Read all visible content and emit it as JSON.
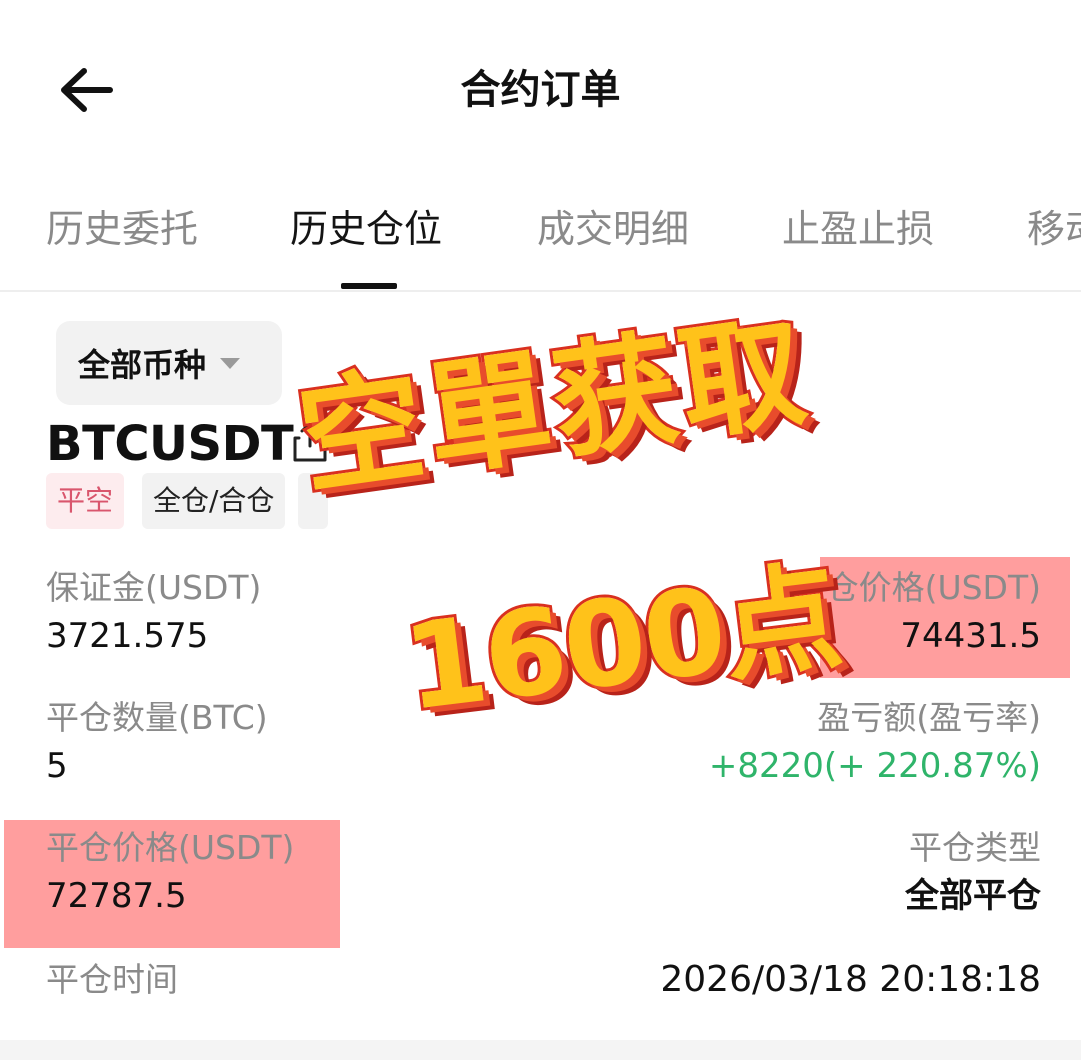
{
  "header": {
    "title": "合约订单",
    "back_icon": "arrow-left-icon"
  },
  "tabs": [
    {
      "label": "历史委托",
      "active": false
    },
    {
      "label": "历史仓位",
      "active": true
    },
    {
      "label": "成交明细",
      "active": false
    },
    {
      "label": "止盈止损",
      "active": false
    },
    {
      "label": "移动",
      "active": false
    }
  ],
  "filter": {
    "label": "全部币种"
  },
  "position": {
    "symbol": "BTCUSDT",
    "side_tag": "平空",
    "mode_tag": "全仓/合仓",
    "margin_label": "保证金(USDT)",
    "margin_value": "3721.575",
    "open_price_label": "开仓价格(USDT)",
    "open_price_value": "74431.5",
    "close_qty_label": "平仓数量(BTC)",
    "close_qty_value": "5",
    "pnl_label": "盈亏额(盈亏率)",
    "pnl_value": "+8220(+ 220.87%)",
    "close_price_label": "平仓价格(USDT)",
    "close_price_value": "72787.5",
    "close_type_label": "平仓类型",
    "close_type_value": "全部平仓",
    "close_time_label": "平仓时间",
    "close_time_value": "2026/03/18 20:18:18"
  },
  "overlay": {
    "line1": "空單获取",
    "line2": "1600点"
  },
  "colors": {
    "profit": "#2fb46a",
    "side_tag_text": "#d9566d",
    "side_tag_bg": "#fdecee",
    "highlight": "#ff9a9a",
    "sticker_fill": "#ffc21a",
    "sticker_stroke": "#d9301f"
  }
}
